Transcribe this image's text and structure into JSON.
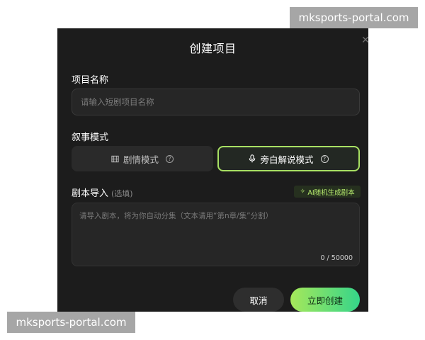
{
  "dialog": {
    "title": "创建项目",
    "close_icon": "close-icon"
  },
  "project_name": {
    "label": "项目名称",
    "placeholder": "请输入短剧项目名称",
    "value": ""
  },
  "narrative_mode": {
    "label": "叙事模式",
    "options": [
      {
        "label": "剧情模式",
        "icon": "film-icon",
        "selected": false
      },
      {
        "label": "旁白解说模式",
        "icon": "microphone-icon",
        "selected": true
      }
    ]
  },
  "script_import": {
    "label": "剧本导入",
    "hint": "(选填)",
    "ai_button": "AI随机生成剧本",
    "placeholder": "请导入剧本，将为你自动分集（文本请用“第n章/集”分割）",
    "value": "",
    "counter": "0 / 50000"
  },
  "actions": {
    "cancel": "取消",
    "create": "立即创建"
  },
  "watermarks": {
    "top": "mksports-portal.com",
    "bottom": "mksports-portal.com"
  },
  "colors": {
    "dialog_bg": "#1c1c1c",
    "accent": "#a8e063",
    "create_gradient_start": "#a6e85a",
    "create_gradient_end": "#35d58a"
  }
}
